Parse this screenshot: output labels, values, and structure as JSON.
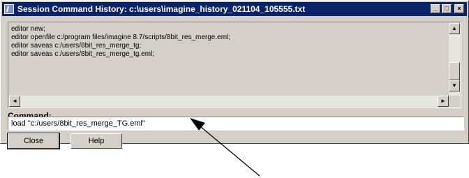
{
  "window": {
    "title": "Session Command History: c:\\users\\imagine_history_021104_105555.txt",
    "controls": {
      "minimize": "_",
      "maximize": "□",
      "close": "×"
    }
  },
  "history": {
    "lines": [
      "editor new;",
      "editor openfile c:/program files/imagine 8.7/scripts/8bit_res_merge.eml;",
      "editor saveas c:/users/8bit_res_merge_tg;",
      "editor saveas c:/users/8bit_res_merge_tg.eml;"
    ]
  },
  "command": {
    "label": "Command:",
    "value": "load \"c:/users/8bit_res_merge_TG.eml\""
  },
  "buttons": {
    "close": "Close",
    "help": "Help"
  },
  "icons": {
    "app": "imagine-app-icon",
    "scroll_up": "arrow-up-icon",
    "scroll_down": "arrow-down-icon",
    "scroll_left": "arrow-left-icon",
    "scroll_right": "arrow-right-icon"
  }
}
